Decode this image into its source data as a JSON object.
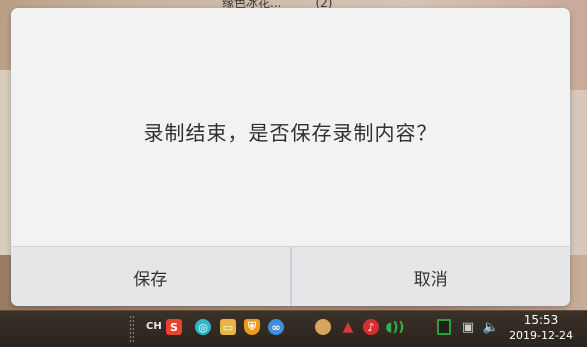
{
  "background": {
    "caption": "缘色冰花...",
    "caption_count": "(2)"
  },
  "dialog": {
    "message": "录制结束，是否保存录制内容？",
    "buttons": {
      "save_label": "保存",
      "cancel_label": "取消"
    }
  },
  "taskbar": {
    "language": "CH",
    "tray_icons": [
      {
        "name": "sogou-input-icon",
        "color": "#e8432c"
      },
      {
        "name": "app-teal-icon",
        "color": "#2fb7c7"
      },
      {
        "name": "folder-icon",
        "color": "#e7b544"
      },
      {
        "name": "shield-icon",
        "color": "#f09a1d"
      },
      {
        "name": "baidu-netdisk-icon",
        "color": "#3f8fe0"
      },
      {
        "name": "weather-icon",
        "color": "#d8a460"
      },
      {
        "name": "game-icon",
        "color": "#d23b3b"
      },
      {
        "name": "netease-music-icon",
        "color": "#d62f2f"
      },
      {
        "name": "sound-app-icon",
        "color": "#2fb34b"
      },
      {
        "name": "battery-icon",
        "color": "#2f9f3a"
      },
      {
        "name": "network-icon",
        "color": "#cfcfcf"
      },
      {
        "name": "volume-icon",
        "color": "#e6e6e6"
      }
    ],
    "clock_time": "15:53",
    "clock_date": "2019-12-24"
  }
}
